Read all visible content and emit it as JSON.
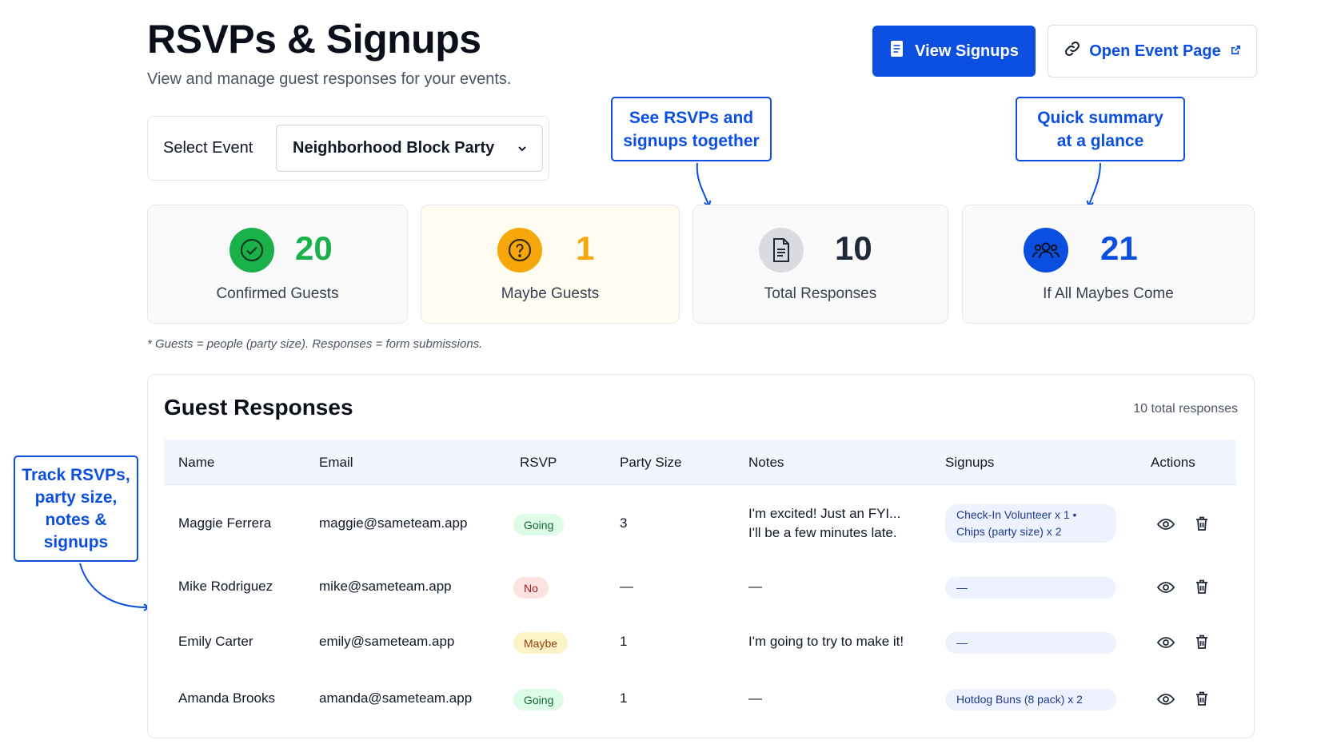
{
  "header": {
    "title": "RSVPs & Signups",
    "subtitle": "View and manage guest responses for your events.",
    "view_signups_label": "View Signups",
    "open_event_label": "Open Event Page"
  },
  "event_select": {
    "label": "Select Event",
    "value": "Neighborhood Block Party"
  },
  "stats": [
    {
      "value": "20",
      "label": "Confirmed Guests",
      "icon": "check-circle-icon",
      "color": "#1bb14a"
    },
    {
      "value": "1",
      "label": "Maybe Guests",
      "icon": "question-circle-icon",
      "color": "#f5a70b"
    },
    {
      "value": "10",
      "label": "Total Responses",
      "icon": "document-icon",
      "color": "#1f2937"
    },
    {
      "value": "21",
      "label": "If All Maybes Come",
      "icon": "group-icon",
      "color": "#0b4fe0"
    }
  ],
  "footnote": "* Guests = people (party size). Responses = form submissions.",
  "callouts": {
    "together": [
      "See RSVPs and",
      "signups together"
    ],
    "summary": [
      "Quick summary",
      "at a glance"
    ],
    "track": [
      "Track RSVPs,",
      "party size,",
      "notes &",
      "signups"
    ]
  },
  "table": {
    "title": "Guest Responses",
    "count": "10 total responses",
    "headers": [
      "Name",
      "Email",
      "RSVP",
      "Party Size",
      "Notes",
      "Signups",
      "Actions"
    ],
    "rows": [
      {
        "name": "Maggie Ferrera",
        "email": "maggie@sameteam.app",
        "rsvp": "Going",
        "party": "3",
        "notes_1": "I'm excited! Just an FYI...",
        "notes_2": "I'll be a few minutes late.",
        "signups_1": "Check-In Volunteer x 1 •",
        "signups_2": "Chips (party size) x 2"
      },
      {
        "name": "Mike Rodriguez",
        "email": "mike@sameteam.app",
        "rsvp": "No",
        "party": "—",
        "notes_1": "—",
        "signups_1": "—"
      },
      {
        "name": "Emily Carter",
        "email": "emily@sameteam.app",
        "rsvp": "Maybe",
        "party": "1",
        "notes_1": "I'm going to try to make it!",
        "signups_1": "—"
      },
      {
        "name": "Amanda Brooks",
        "email": "amanda@sameteam.app",
        "rsvp": "Going",
        "party": "1",
        "notes_1": "—",
        "signups_1": "Hotdog Buns (8 pack) x 2"
      }
    ]
  }
}
